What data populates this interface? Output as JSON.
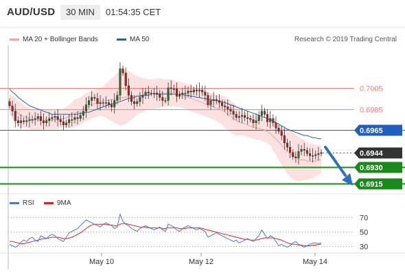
{
  "header": {
    "symbol": "AUD/USD",
    "interval": "30 MIN",
    "time": "01:54:35 CET"
  },
  "legend": {
    "ma20_label": "MA 20 + Bollinger Bands",
    "ma50_label": "MA 50",
    "credit": "Research © 2019 Trading Central"
  },
  "rsi_legend": {
    "rsi_label": "RSI",
    "ma_label": "9MA"
  },
  "colors": {
    "ma20": "#f4a3a3",
    "ma50": "#2e5f9e",
    "band_fill": "#fbdcdc",
    "resistance": "#f08080",
    "pivot": "#1f5fbf",
    "support": "#1a8a1a",
    "price_tag": "#333333",
    "arrow": "#2e6fb5",
    "rsi": "#4a78d0",
    "rsi_ma": "#e02020",
    "up": "#2a6e2a",
    "down": "#b02020"
  },
  "chart_data": [
    {
      "type": "candlestick",
      "x_tick_labels": [
        "May 10",
        "May 12",
        "May 14"
      ],
      "y_tick_labels": [
        "0.7005",
        "0.6985",
        "0.6965",
        "0.6944",
        "0.6930",
        "0.6915"
      ],
      "ylim": [
        0.6905,
        0.7045
      ],
      "levels": [
        {
          "value": 0.7005,
          "label": "0.7005",
          "kind": "resistance"
        },
        {
          "value": 0.6985,
          "label": "0.6985",
          "kind": "resistance"
        },
        {
          "value": 0.6965,
          "label": "0.6965",
          "kind": "pivot"
        },
        {
          "value": 0.6944,
          "label": "0.6944",
          "kind": "last"
        },
        {
          "value": 0.693,
          "label": "0.6930",
          "kind": "support"
        },
        {
          "value": 0.6915,
          "label": "0.6915",
          "kind": "support"
        }
      ],
      "close": [
        0.6988,
        0.6983,
        0.6974,
        0.6972,
        0.6974,
        0.6973,
        0.6974,
        0.6975,
        0.6975,
        0.6976,
        0.6978,
        0.6974,
        0.6972,
        0.6974,
        0.6976,
        0.6977,
        0.6978,
        0.6975,
        0.6973,
        0.697,
        0.6972,
        0.6975,
        0.6975,
        0.6977,
        0.6976,
        0.6979,
        0.6983,
        0.6989,
        0.6993,
        0.6996,
        0.6995,
        0.699,
        0.6991,
        0.6991,
        0.6991,
        0.6989,
        0.6987,
        0.6993,
        0.6998,
        0.7023,
        0.7019,
        0.7007,
        0.6998,
        0.6992,
        0.699,
        0.6992,
        0.6996,
        0.6998,
        0.7001,
        0.7,
        0.7,
        0.7,
        0.6999,
        0.6996,
        0.6993,
        0.6993,
        0.7005,
        0.7004,
        0.7004,
        0.6997,
        0.6999,
        0.7,
        0.7,
        0.7002,
        0.7001,
        0.7003,
        0.7002,
        0.7003,
        0.7001,
        0.6998,
        0.6989,
        0.6993,
        0.6994,
        0.6993,
        0.6991,
        0.6988,
        0.6987,
        0.6985,
        0.6983,
        0.698,
        0.6977,
        0.6978,
        0.6979,
        0.6977,
        0.6976,
        0.6975,
        0.6972,
        0.6974,
        0.6979,
        0.6983,
        0.698,
        0.6973,
        0.6976,
        0.6972,
        0.6967,
        0.6964,
        0.696,
        0.6953,
        0.6949,
        0.6944,
        0.694,
        0.6939,
        0.6945,
        0.6947,
        0.6946,
        0.6943,
        0.6941,
        0.6941,
        0.6942,
        0.6943,
        0.6944
      ],
      "ma20": [
        0.699,
        0.6987,
        0.6984,
        0.6981,
        0.6979,
        0.6978,
        0.6977,
        0.6976,
        0.6975,
        0.6975,
        0.6975,
        0.6975,
        0.6975,
        0.6975,
        0.6975,
        0.6975,
        0.6975,
        0.6975,
        0.6976,
        0.6976,
        0.6977,
        0.6978,
        0.6979,
        0.6981,
        0.6982,
        0.6983,
        0.6985,
        0.6987,
        0.6988,
        0.6989,
        0.699,
        0.6991,
        0.6992,
        0.6992,
        0.6993,
        0.6993,
        0.6994,
        0.6994,
        0.6995,
        0.6995,
        0.6996,
        0.6996,
        0.6997,
        0.6997,
        0.6997,
        0.6998,
        0.6998,
        0.6998,
        0.6999,
        0.6999,
        0.6999,
        0.6999,
        0.7,
        0.7,
        0.7,
        0.7,
        0.7,
        0.7,
        0.7,
        0.6999,
        0.6999,
        0.6998,
        0.6997,
        0.6996,
        0.6995,
        0.6994,
        0.6993,
        0.6992,
        0.6991,
        0.699,
        0.6989,
        0.6988,
        0.6987,
        0.6986,
        0.6985,
        0.6984,
        0.6982,
        0.698,
        0.6978,
        0.6976,
        0.6974,
        0.6973,
        0.6972,
        0.6971,
        0.697,
        0.6969,
        0.6968,
        0.6967,
        0.6967,
        0.6966,
        0.6965,
        0.6964,
        0.6962,
        0.6959,
        0.6957,
        0.6954,
        0.6951,
        0.6948,
        0.6945,
        0.6943,
        0.6941,
        0.6939,
        0.6938,
        0.6937,
        0.6937,
        0.6936,
        0.6936,
        0.6936,
        0.6936,
        0.6937,
        0.6937
      ],
      "ma50": [
        0.7004,
        0.7001,
        0.6999,
        0.6996,
        0.6994,
        0.6992,
        0.699,
        0.6988,
        0.6987,
        0.6986,
        0.6985,
        0.6984,
        0.6983,
        0.6982,
        0.6981,
        0.698,
        0.698,
        0.698,
        0.698,
        0.698,
        0.698,
        0.698,
        0.698,
        0.698,
        0.698,
        0.6981,
        0.6981,
        0.6982,
        0.6982,
        0.6983,
        0.6984,
        0.6985,
        0.6986,
        0.6987,
        0.6988,
        0.6989,
        0.699,
        0.699,
        0.6991,
        0.6992,
        0.6993,
        0.6994,
        0.6995,
        0.6995,
        0.6996,
        0.6997,
        0.6997,
        0.6998,
        0.6998,
        0.6998,
        0.6999,
        0.6999,
        0.6999,
        0.6999,
        0.6999,
        0.6999,
        0.6999,
        0.6999,
        0.6999,
        0.6999,
        0.6999,
        0.6999,
        0.6998,
        0.6998,
        0.6997,
        0.6997,
        0.6996,
        0.6996,
        0.6995,
        0.6995,
        0.6994,
        0.6994,
        0.6993,
        0.6993,
        0.6992,
        0.6992,
        0.6991,
        0.699,
        0.6989,
        0.6988,
        0.6987,
        0.6986,
        0.6985,
        0.6984,
        0.6983,
        0.6982,
        0.6981,
        0.698,
        0.6979,
        0.6978,
        0.6977,
        0.6976,
        0.6975,
        0.6974,
        0.6972,
        0.6971,
        0.6969,
        0.6968,
        0.6966,
        0.6965,
        0.6964,
        0.6963,
        0.6962,
        0.6961,
        0.696,
        0.696,
        0.6959,
        0.6958,
        0.6958,
        0.6957,
        0.6957
      ],
      "band_width": [
        0.001,
        0.0011,
        0.0012,
        0.0012,
        0.0012,
        0.0011,
        0.001,
        0.001,
        0.001,
        0.001,
        0.001,
        0.001,
        0.001,
        0.0009,
        0.0009,
        0.0009,
        0.0009,
        0.0009,
        0.0009,
        0.0009,
        0.001,
        0.0011,
        0.0012,
        0.0013,
        0.0013,
        0.0013,
        0.0013,
        0.0013,
        0.0013,
        0.0013,
        0.0013,
        0.0013,
        0.0013,
        0.0014,
        0.0016,
        0.0018,
        0.002,
        0.0022,
        0.0024,
        0.0026,
        0.0026,
        0.0025,
        0.0024,
        0.0022,
        0.002,
        0.0018,
        0.0017,
        0.0016,
        0.0015,
        0.0014,
        0.0014,
        0.0014,
        0.0014,
        0.0014,
        0.0013,
        0.0013,
        0.0013,
        0.0013,
        0.0012,
        0.0012,
        0.0012,
        0.0012,
        0.0012,
        0.0012,
        0.0012,
        0.0012,
        0.0012,
        0.0012,
        0.0012,
        0.0012,
        0.0012,
        0.0012,
        0.0012,
        0.0012,
        0.0013,
        0.0014,
        0.0015,
        0.0015,
        0.0015,
        0.0015,
        0.0014,
        0.0013,
        0.0012,
        0.0011,
        0.0011,
        0.0011,
        0.0011,
        0.0011,
        0.0011,
        0.0011,
        0.0011,
        0.0011,
        0.0011,
        0.0013,
        0.0015,
        0.0017,
        0.0019,
        0.002,
        0.0021,
        0.0022,
        0.0022,
        0.0022,
        0.0021,
        0.002,
        0.0019,
        0.0018,
        0.0017,
        0.0016,
        0.0015,
        0.0014,
        0.0013
      ]
    },
    {
      "type": "line",
      "series": [
        {
          "name": "RSI",
          "values": [
            32,
            30,
            28,
            30,
            35,
            38,
            36,
            40,
            42,
            38,
            36,
            44,
            42,
            40,
            44,
            46,
            44,
            40,
            38,
            36,
            42,
            48,
            50,
            52,
            54,
            58,
            62,
            66,
            64,
            62,
            60,
            58,
            56,
            60,
            62,
            60,
            58,
            54,
            56,
            74,
            64,
            60,
            58,
            54,
            52,
            50,
            54,
            56,
            58,
            56,
            54,
            52,
            54,
            56,
            52,
            50,
            60,
            58,
            56,
            52,
            50,
            54,
            56,
            58,
            56,
            54,
            52,
            54,
            52,
            50,
            42,
            44,
            46,
            48,
            46,
            44,
            42,
            40,
            38,
            36,
            38,
            34,
            36,
            38,
            40,
            38,
            36,
            40,
            44,
            52,
            46,
            40,
            44,
            42,
            36,
            30,
            32,
            30,
            28,
            30,
            34,
            36,
            32,
            30,
            28,
            30,
            32,
            34,
            34,
            33,
            34
          ]
        },
        {
          "name": "9MA",
          "values": [
            36,
            36,
            35,
            34,
            33,
            33,
            34,
            35,
            36,
            37,
            38,
            39,
            40,
            40,
            41,
            42,
            42,
            42,
            41,
            40,
            40,
            41,
            42,
            44,
            46,
            48,
            51,
            54,
            57,
            59,
            60,
            60,
            60,
            60,
            60,
            59,
            59,
            58,
            58,
            60,
            61,
            61,
            60,
            59,
            58,
            57,
            56,
            56,
            56,
            55,
            55,
            55,
            55,
            55,
            54,
            54,
            55,
            55,
            55,
            55,
            54,
            54,
            54,
            55,
            55,
            55,
            55,
            55,
            54,
            53,
            52,
            51,
            50,
            49,
            48,
            47,
            46,
            45,
            44,
            43,
            42,
            41,
            40,
            39,
            39,
            38,
            38,
            38,
            39,
            40,
            41,
            41,
            41,
            41,
            40,
            39,
            38,
            36,
            34,
            33,
            32,
            32,
            31,
            31,
            30,
            30,
            30,
            31,
            31,
            32,
            32
          ]
        }
      ],
      "y_tick_labels": [
        "70",
        "50",
        "30"
      ],
      "y_ticks": [
        70,
        50,
        30
      ],
      "ylim": [
        20,
        85
      ]
    }
  ]
}
